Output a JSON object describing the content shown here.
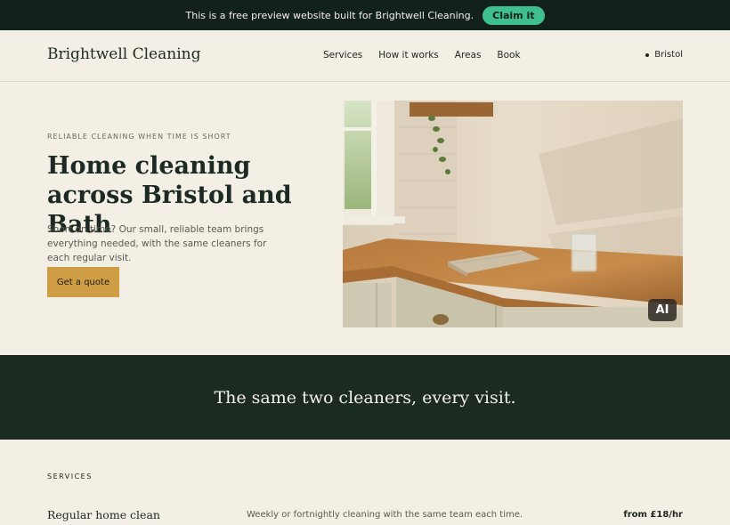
{
  "banner": {
    "message": "This is a free preview website built for Brightwell Cleaning.",
    "claim_label": "Claim it"
  },
  "nav": {
    "brand": "Brightwell Cleaning",
    "links": [
      "Services",
      "How it works",
      "Areas",
      "Book"
    ],
    "city": "Bristol"
  },
  "hero": {
    "eyebrow": "RELIABLE CLEANING WHEN TIME IS SHORT",
    "title": "Home cleaning across Bristol and Bath",
    "subtitle": "Short on time? Our small, reliable team brings everything needed, with the same cleaners for each regular visit.",
    "cta_label": "Get a quote",
    "image_badge": "AI"
  },
  "band": {
    "quote": "The same two cleaners, every visit."
  },
  "services": {
    "label": "SERVICES",
    "items": [
      {
        "name": "Regular home clean",
        "description": "Weekly or fortnightly cleaning with the same team each time.",
        "price": "from £18/hr"
      }
    ]
  },
  "colors": {
    "dark_green": "#13211d",
    "claim_green": "#3fbf8e",
    "cream": "#f3efe5",
    "mustard": "#cf9e44"
  }
}
